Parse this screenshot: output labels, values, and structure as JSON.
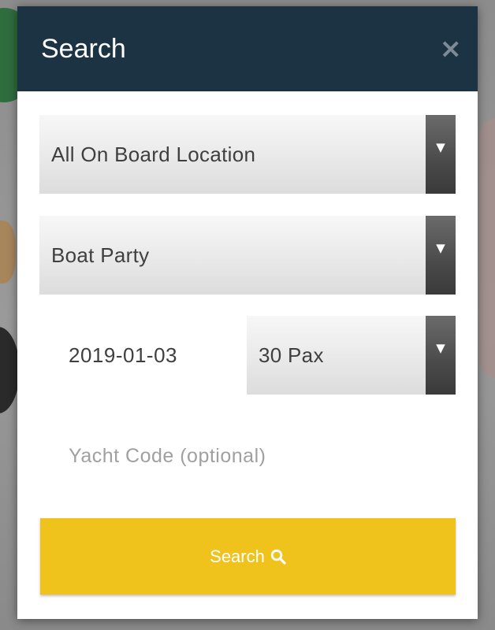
{
  "modal": {
    "title": "Search",
    "close_label": "×"
  },
  "form": {
    "location_select": {
      "value": "All On Board Location"
    },
    "type_select": {
      "value": "Boat Party"
    },
    "date_input": {
      "value": "2019-01-03"
    },
    "pax_select": {
      "value": "30 Pax"
    },
    "yacht_code_input": {
      "value": "",
      "placeholder": "Yacht Code (optional)"
    },
    "dropdown_arrow": "▼",
    "search_button_label": "Search",
    "search_icon": "search-icon"
  },
  "colors": {
    "header_bg": "#1c3344",
    "button_bg": "#f0c21c"
  }
}
